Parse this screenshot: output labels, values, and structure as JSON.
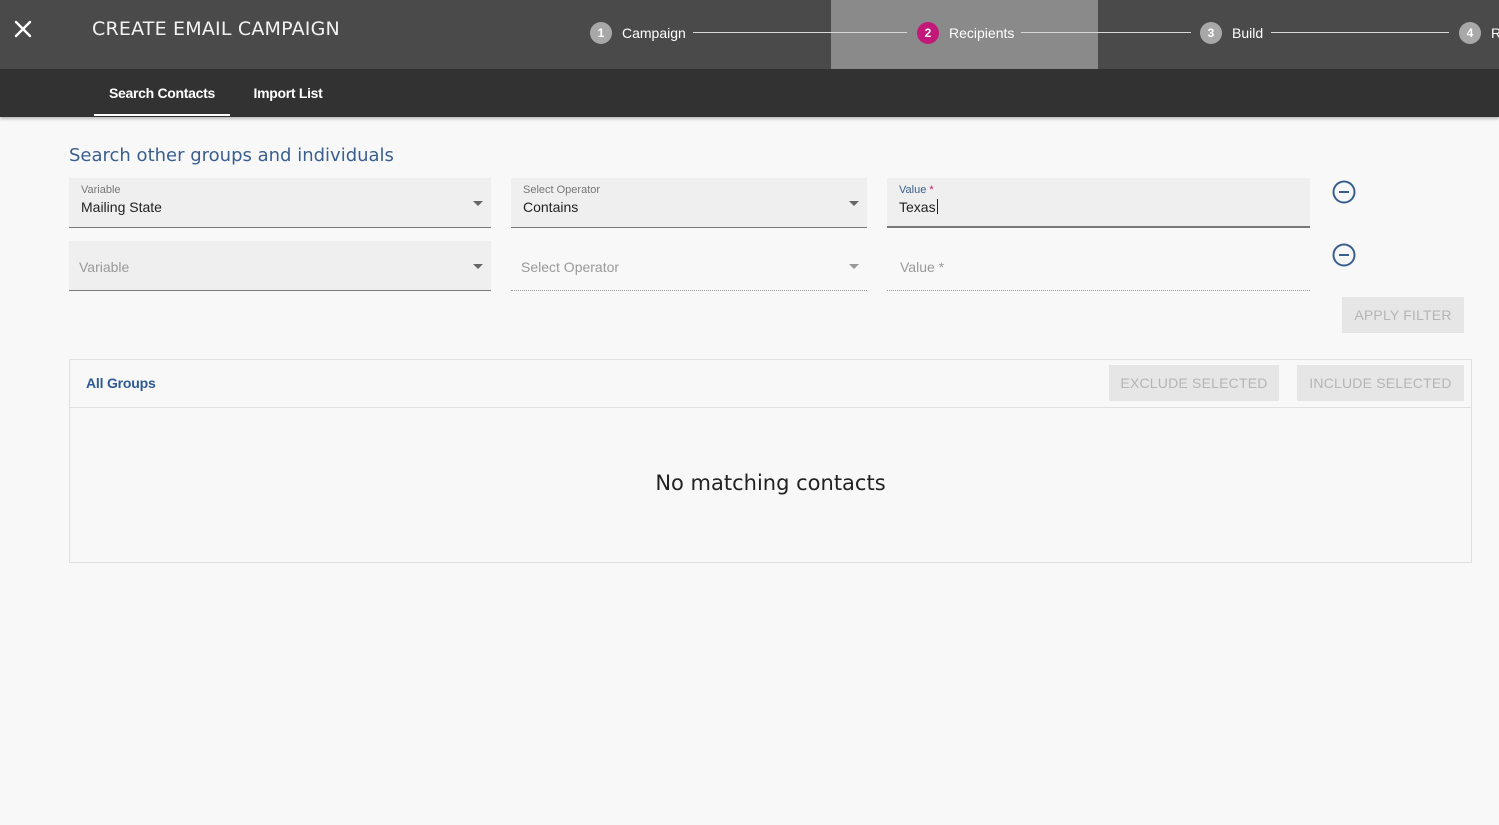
{
  "header": {
    "title": "CREATE EMAIL CAMPAIGN",
    "close_icon": "close-icon",
    "steps": [
      {
        "num": "1",
        "label": "Campaign",
        "active": false
      },
      {
        "num": "2",
        "label": "Recipients",
        "active": true
      },
      {
        "num": "3",
        "label": "Build",
        "active": false
      },
      {
        "num": "4",
        "label": "R",
        "active": false
      }
    ],
    "colors": {
      "active_step": "#c2187a",
      "bar": "#4a4a4a"
    }
  },
  "tabs": [
    {
      "label": "Search Contacts",
      "active": true
    },
    {
      "label": "Import List",
      "active": false
    }
  ],
  "search": {
    "title": "Search other groups and individuals",
    "rows": [
      {
        "variable": {
          "label": "Variable",
          "value": "Mailing State"
        },
        "operator": {
          "label": "Select Operator",
          "value": "Contains"
        },
        "value": {
          "label": "Value",
          "required_mark": "*",
          "value": "Texas"
        }
      },
      {
        "variable": {
          "placeholder": "Variable"
        },
        "operator": {
          "placeholder": "Select Operator"
        },
        "value": {
          "placeholder": "Value *"
        }
      }
    ],
    "apply_filter": "APPLY FILTER"
  },
  "groups": {
    "title": "All Groups",
    "exclude_selected": "EXCLUDE SELECTED",
    "include_selected": "INCLUDE SELECTED",
    "empty_message": "No matching contacts"
  }
}
